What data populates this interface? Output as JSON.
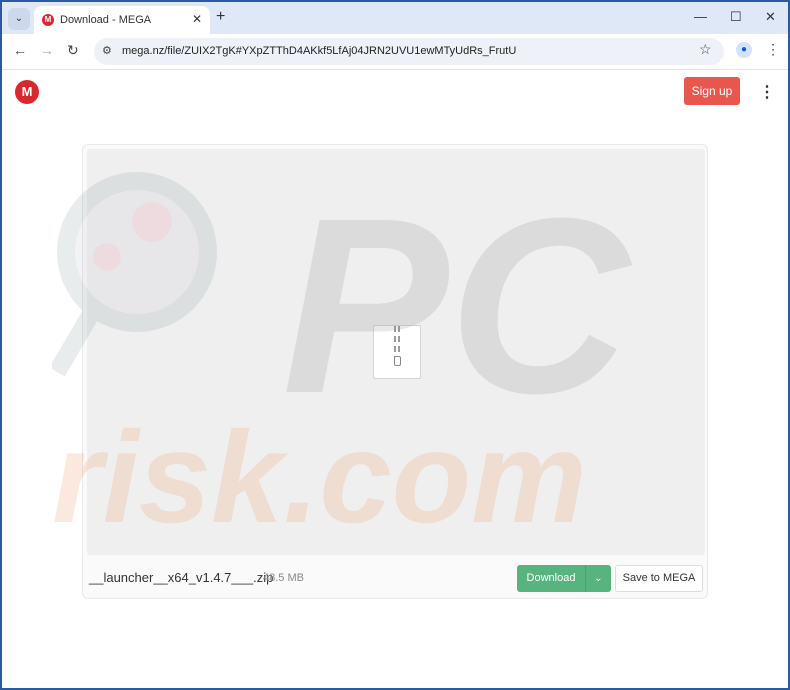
{
  "browser": {
    "tab_title": "Download - MEGA",
    "favicon": "M",
    "url": "mega.nz/file/ZUIX2TgK#YXpZTThD4AKkf5LfAj04JRN2UVU1ewMTyUdRs_FrutU"
  },
  "header": {
    "logo": "M",
    "signup_label": "Sign up",
    "accent": "#e8574d"
  },
  "file": {
    "name": "__launcher__x64_v1.4.7___.zip",
    "size": "48.5 MB"
  },
  "actions": {
    "download_label": "Download",
    "save_label": "Save to MEGA",
    "download_color": "#57b47e"
  },
  "watermark": {
    "text": "PC risk.com"
  }
}
